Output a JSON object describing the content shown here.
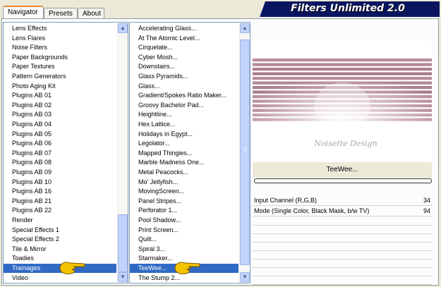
{
  "tabs": [
    {
      "label": "Navigator",
      "active": true
    },
    {
      "label": "Presets",
      "active": false
    },
    {
      "label": "About",
      "active": false
    }
  ],
  "banner": {
    "title": "Filters Unlimited 2.0"
  },
  "categories": {
    "items": [
      "Lens Effects",
      "Lens Flares",
      "Noise Filters",
      "Paper Backgrounds",
      "Paper Textures",
      "Pattern Generators",
      "Photo Aging Kit",
      "Plugins AB 01",
      "Plugins AB 02",
      "Plugins AB 03",
      "Plugins AB 04",
      "Plugins AB 05",
      "Plugins AB 06",
      "Plugins AB 07",
      "Plugins AB 08",
      "Plugins AB 09",
      "Plugins AB 10",
      "Plugins AB 16",
      "Plugins AB 21",
      "Plugins AB 22",
      "Render",
      "Special Effects 1",
      "Special Effects 2",
      "Tile & Mirror",
      "Toadies",
      "Tramages",
      "Video"
    ],
    "selected": "Tramages"
  },
  "filters": {
    "items": [
      "Accelerating Glass...",
      "At The Atomic Level...",
      "Cirquelate...",
      "Cyber Mosh...",
      "Downstairs...",
      "Glass Pyramids...",
      "Glass...",
      "Gradient/Spokes Ratio Maker...",
      "Groovy Bachelor Pad...",
      "Heightline...",
      "Hex Lattice...",
      "Holidays in Egypt...",
      "Legolator...",
      "Mapped Thingies...",
      "Marble Madness One...",
      "Metal Peacocks...",
      "Mo' Jellyfish...",
      "MovingScreen...",
      "Panel Stripes...",
      "Perforator 1...",
      "Pool Shadow...",
      "Print Screen...",
      "Quilt...",
      "Spiral 3...",
      "Starmaker...",
      "TeeWee...",
      "The Stump 2..."
    ],
    "selected": "TeeWee..."
  },
  "preview": {
    "filter_name": "TeeWee...",
    "watermark": "Noisette Design"
  },
  "parameters": [
    {
      "label": "Input Channel (R,G,B)",
      "value": "34"
    },
    {
      "label": "Mode (Single Color, Black Mask, b/w TV)",
      "value": "94"
    }
  ],
  "empty_param_rows": 8,
  "colors": {
    "pointer_hand": "#f5c400",
    "selection": "#316ac5",
    "banner_bg": "#0a1560",
    "preview_stripe": "#7a2c4a"
  }
}
